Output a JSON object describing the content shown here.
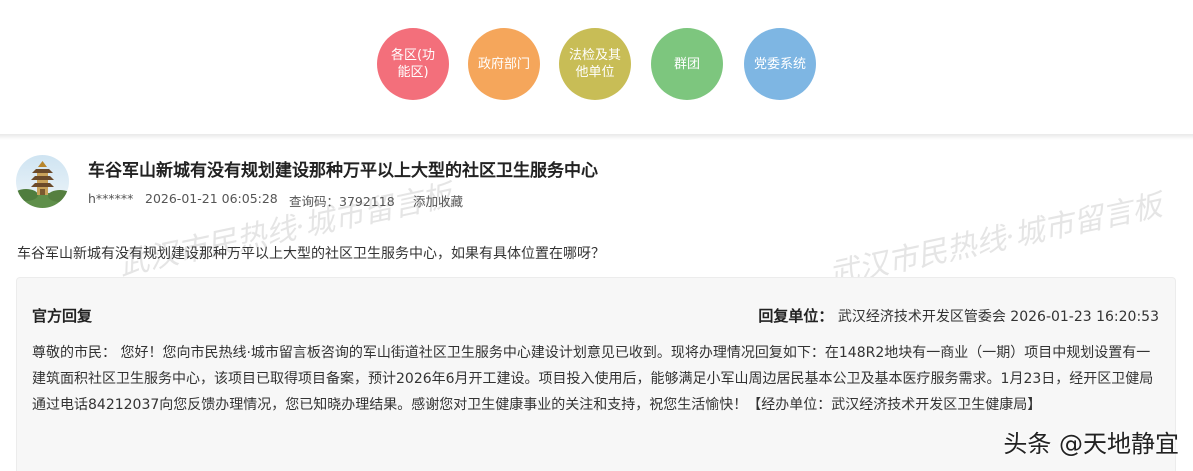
{
  "categories": [
    {
      "label": "各区(功能区)",
      "color": "#f36f7b"
    },
    {
      "label": "政府部门",
      "color": "#f5a65b"
    },
    {
      "label": "法检及其他单位",
      "color": "#c8bd56"
    },
    {
      "label": "群团",
      "color": "#7dc67e"
    },
    {
      "label": "党委系统",
      "color": "#7eb6e3"
    }
  ],
  "post": {
    "title": "车谷军山新城有没有规划建设那种万平以上大型的社区卫生服务中心",
    "user": "h******",
    "time": "2026-01-21 06:05:28",
    "query_code": "查询码：3792118",
    "favorite": "添加收藏",
    "question": "车谷军山新城有没有规划建设那种万平以上大型的社区卫生服务中心，如果有具体位置在哪呀？"
  },
  "reply": {
    "label": "官方回复",
    "unit_label": "回复单位：",
    "unit": "武汉经济技术开发区管委会 2026-01-23 16:20:53",
    "body": "尊敬的市民： 您好！您向市民热线·城市留言板咨询的军山街道社区卫生服务中心建设计划意见已收到。现将办理情况回复如下：在148R2地块有一商业（一期）项目中规划设置有一建筑面积社区卫生服务中心，该项目已取得项目备案，预计2026年6月开工建设。项目投入使用后，能够满足小军山周边居民基本公卫及基本医疗服务需求。1月23日，经开区卫健局通过电话84212037向您反馈办理情况，您已知晓办理结果。感谢您对卫生健康事业的关注和支持，祝您生活愉快！【经办单位：武汉经济技术开发区卫生健康局】"
  },
  "watermark": {
    "text1": "武汉市民热线·城市留言板",
    "text2": "武汉市民热线·城市留言板"
  },
  "footer": {
    "mark": "头条 @天地静宜"
  }
}
